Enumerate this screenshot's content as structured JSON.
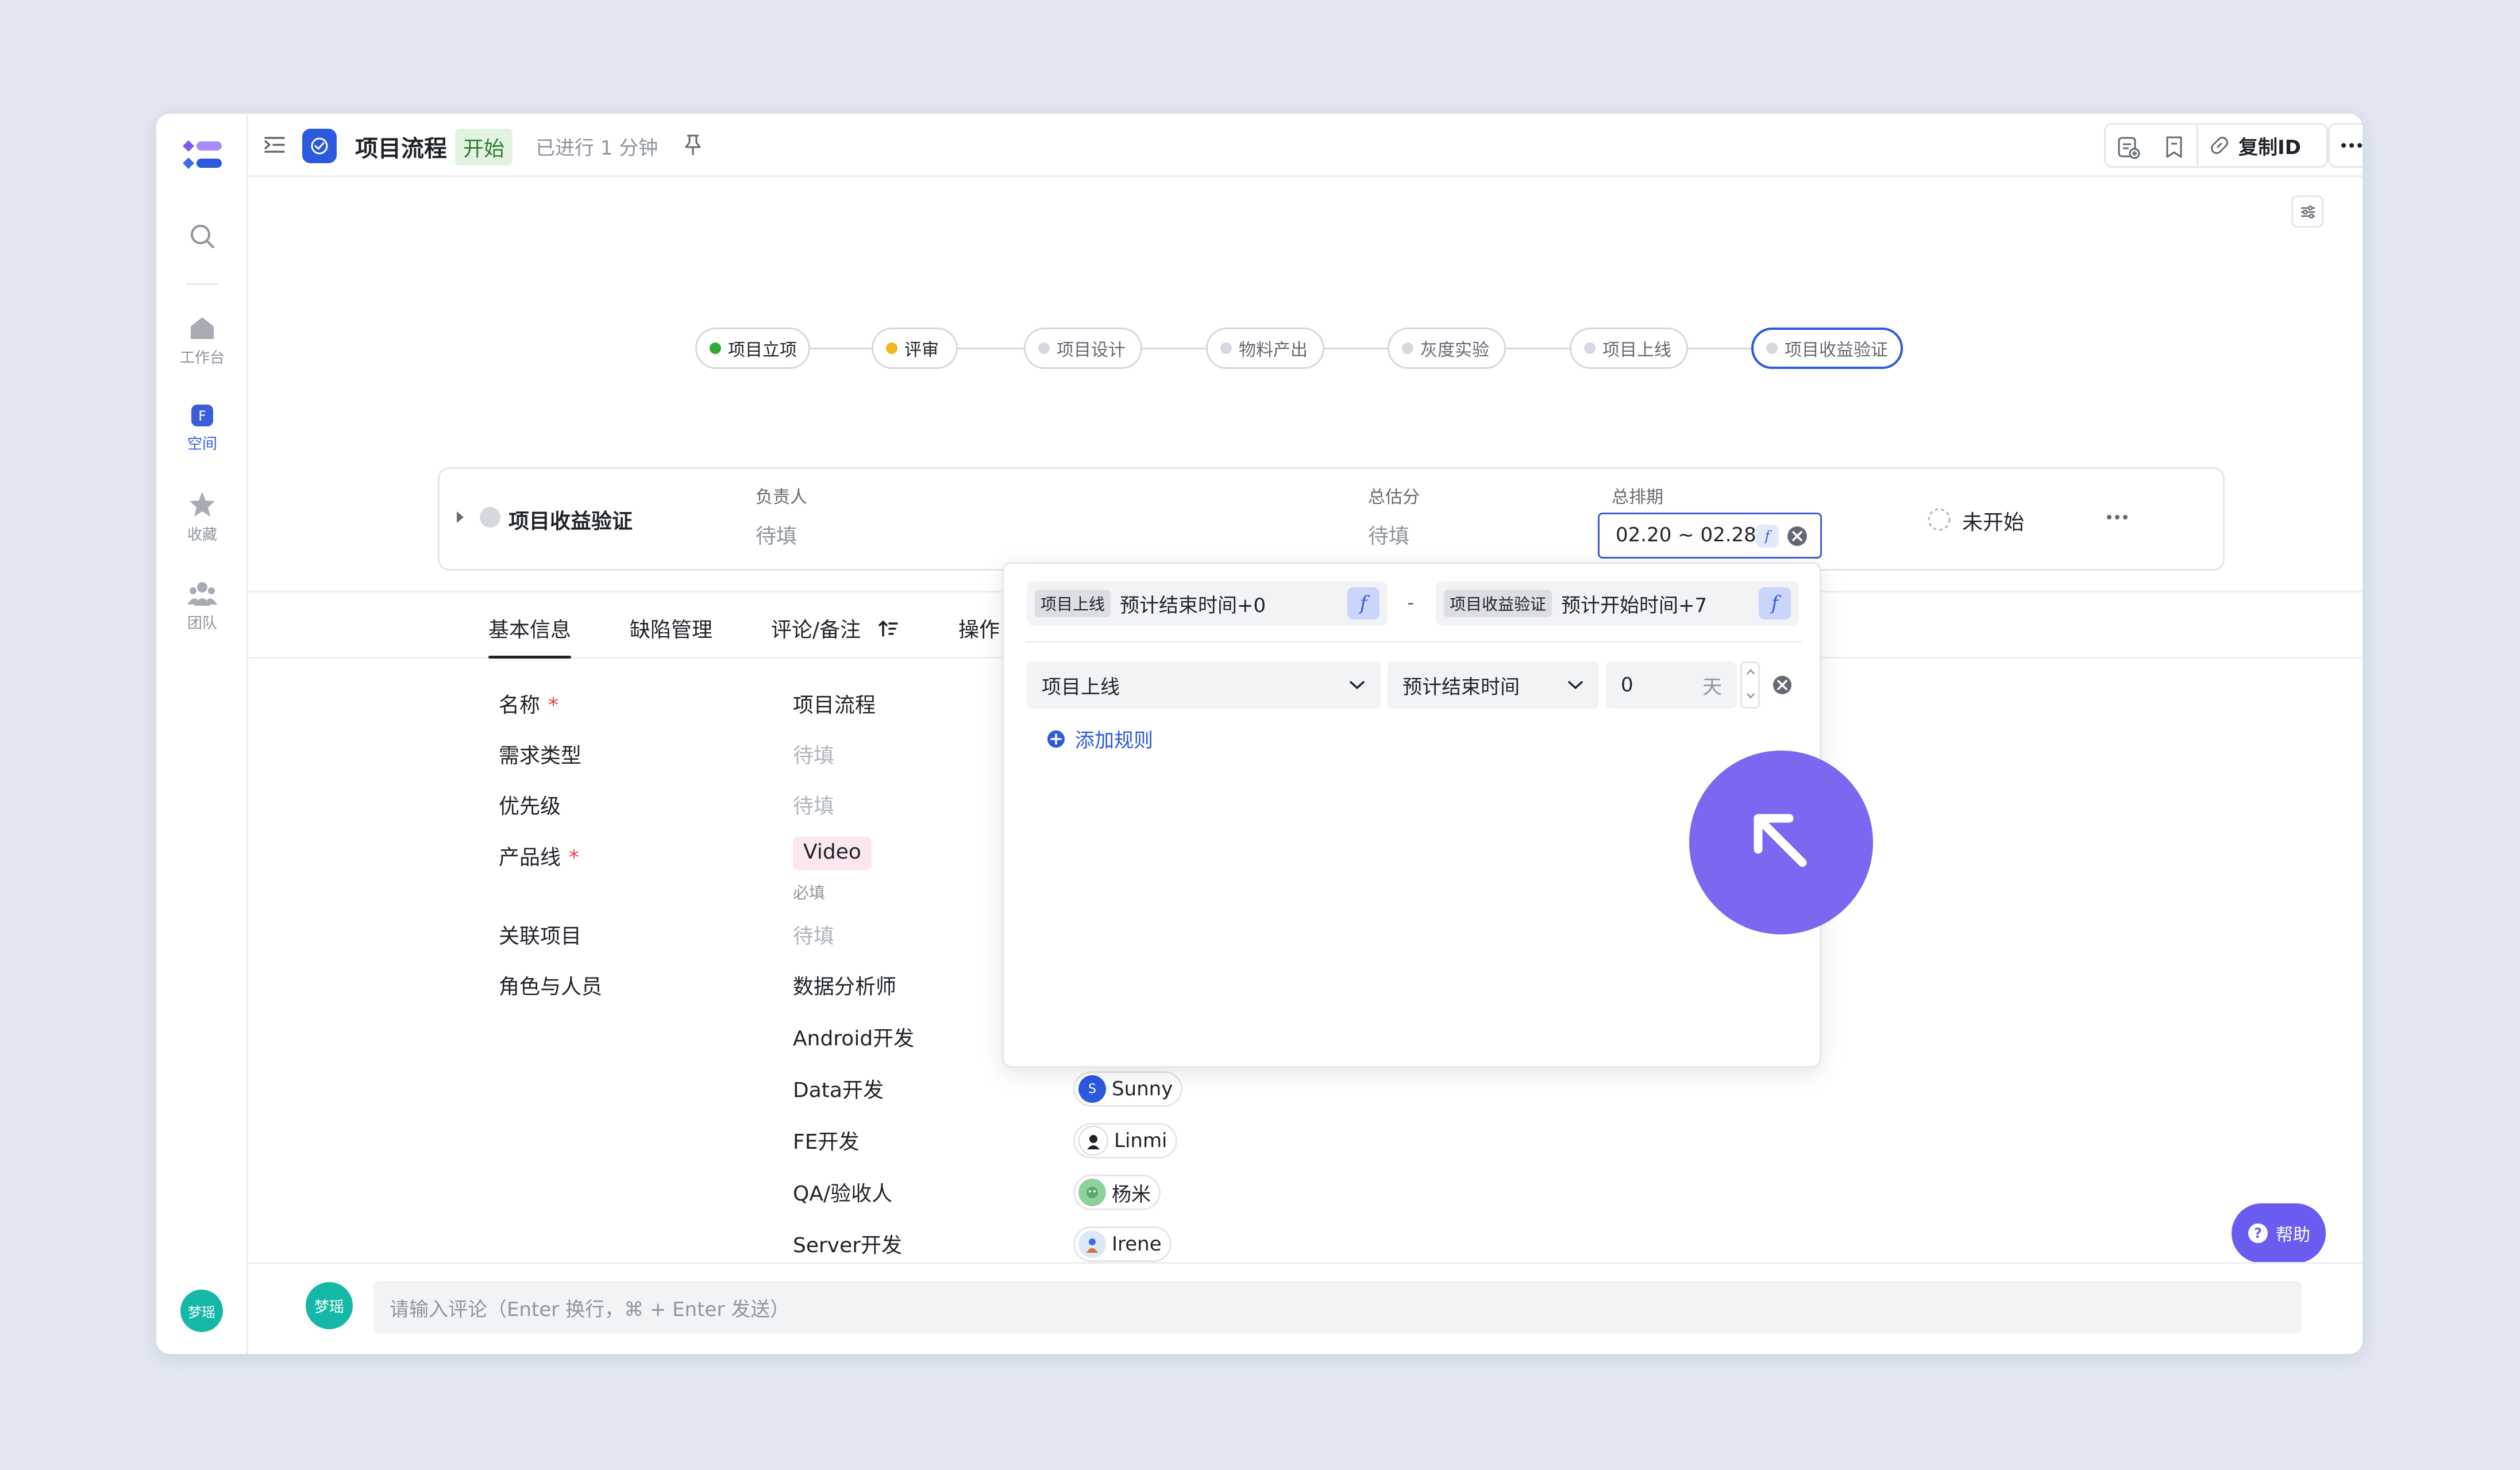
{
  "sidebar": {
    "items": [
      {
        "label": "工作台"
      },
      {
        "label": "空间"
      },
      {
        "label": "收藏"
      },
      {
        "label": "团队"
      }
    ],
    "user_avatar": "梦瑶"
  },
  "header": {
    "title": "项目流程",
    "status_badge": "开始",
    "elapsed": "已进行 1 分钟",
    "copy_id_label": "复制ID"
  },
  "flow": {
    "nodes": [
      {
        "label": "项目立项",
        "status": "done"
      },
      {
        "label": "评审",
        "status": "active"
      },
      {
        "label": "项目设计",
        "status": "todo"
      },
      {
        "label": "物料产出",
        "status": "todo"
      },
      {
        "label": "灰度实验",
        "status": "todo"
      },
      {
        "label": "项目上线",
        "status": "todo"
      },
      {
        "label": "项目收益验证",
        "status": "selected"
      }
    ]
  },
  "node_card": {
    "name": "项目收益验证",
    "owner_label": "负责人",
    "owner_value": "待填",
    "estimate_label": "总估分",
    "estimate_value": "待填",
    "schedule_label": "总排期",
    "schedule_value": "02.20 ~ 02.28",
    "status": "未开始"
  },
  "tabs": [
    {
      "label": "基本信息",
      "active": true
    },
    {
      "label": "缺陷管理",
      "active": false
    },
    {
      "label": "评论/备注",
      "active": false
    },
    {
      "label": "操作",
      "active": false
    }
  ],
  "fields": [
    {
      "label": "名称",
      "required": true,
      "value": "项目流程",
      "placeholder": false
    },
    {
      "label": "需求类型",
      "required": false,
      "value": "待填",
      "placeholder": true
    },
    {
      "label": "优先级",
      "required": false,
      "value": "待填",
      "placeholder": true
    },
    {
      "label": "产品线",
      "required": true,
      "value": "Video",
      "hint": "必填"
    },
    {
      "label": "关联项目",
      "required": false,
      "value": "待填",
      "placeholder": true
    },
    {
      "label": "角色与人员",
      "required": false,
      "value": ""
    }
  ],
  "roles": [
    {
      "role": "数据分析师",
      "person": ""
    },
    {
      "role": "Android开发",
      "person": ""
    },
    {
      "role": "Data开发",
      "person": "Sunny"
    },
    {
      "role": "FE开发",
      "person": "Linmi"
    },
    {
      "role": "QA/验收人",
      "person": "杨米"
    },
    {
      "role": "Server开发",
      "person": "Irene"
    }
  ],
  "popup": {
    "start_rule": {
      "node": "项目上线",
      "expr": "预计结束时间+0"
    },
    "separator": "-",
    "end_rule": {
      "node": "项目收益验证",
      "expr": "预计开始时间+7"
    },
    "rule_row": {
      "node": "项目上线",
      "field": "预计结束时间",
      "offset": "0",
      "unit": "天"
    },
    "add_rule_label": "添加规则"
  },
  "help_label": "帮助",
  "comment": {
    "avatar": "梦瑶",
    "placeholder": "请输入评论（Enter 换行，⌘ + Enter 发送）"
  },
  "colors": {
    "accent": "#3b5ed8",
    "cursor_circle": "#7b68f0",
    "done": "#2eaa3a",
    "active": "#f3b81f",
    "tag_pink": "#fde7ef",
    "avatar_green": "#15b8a6"
  }
}
